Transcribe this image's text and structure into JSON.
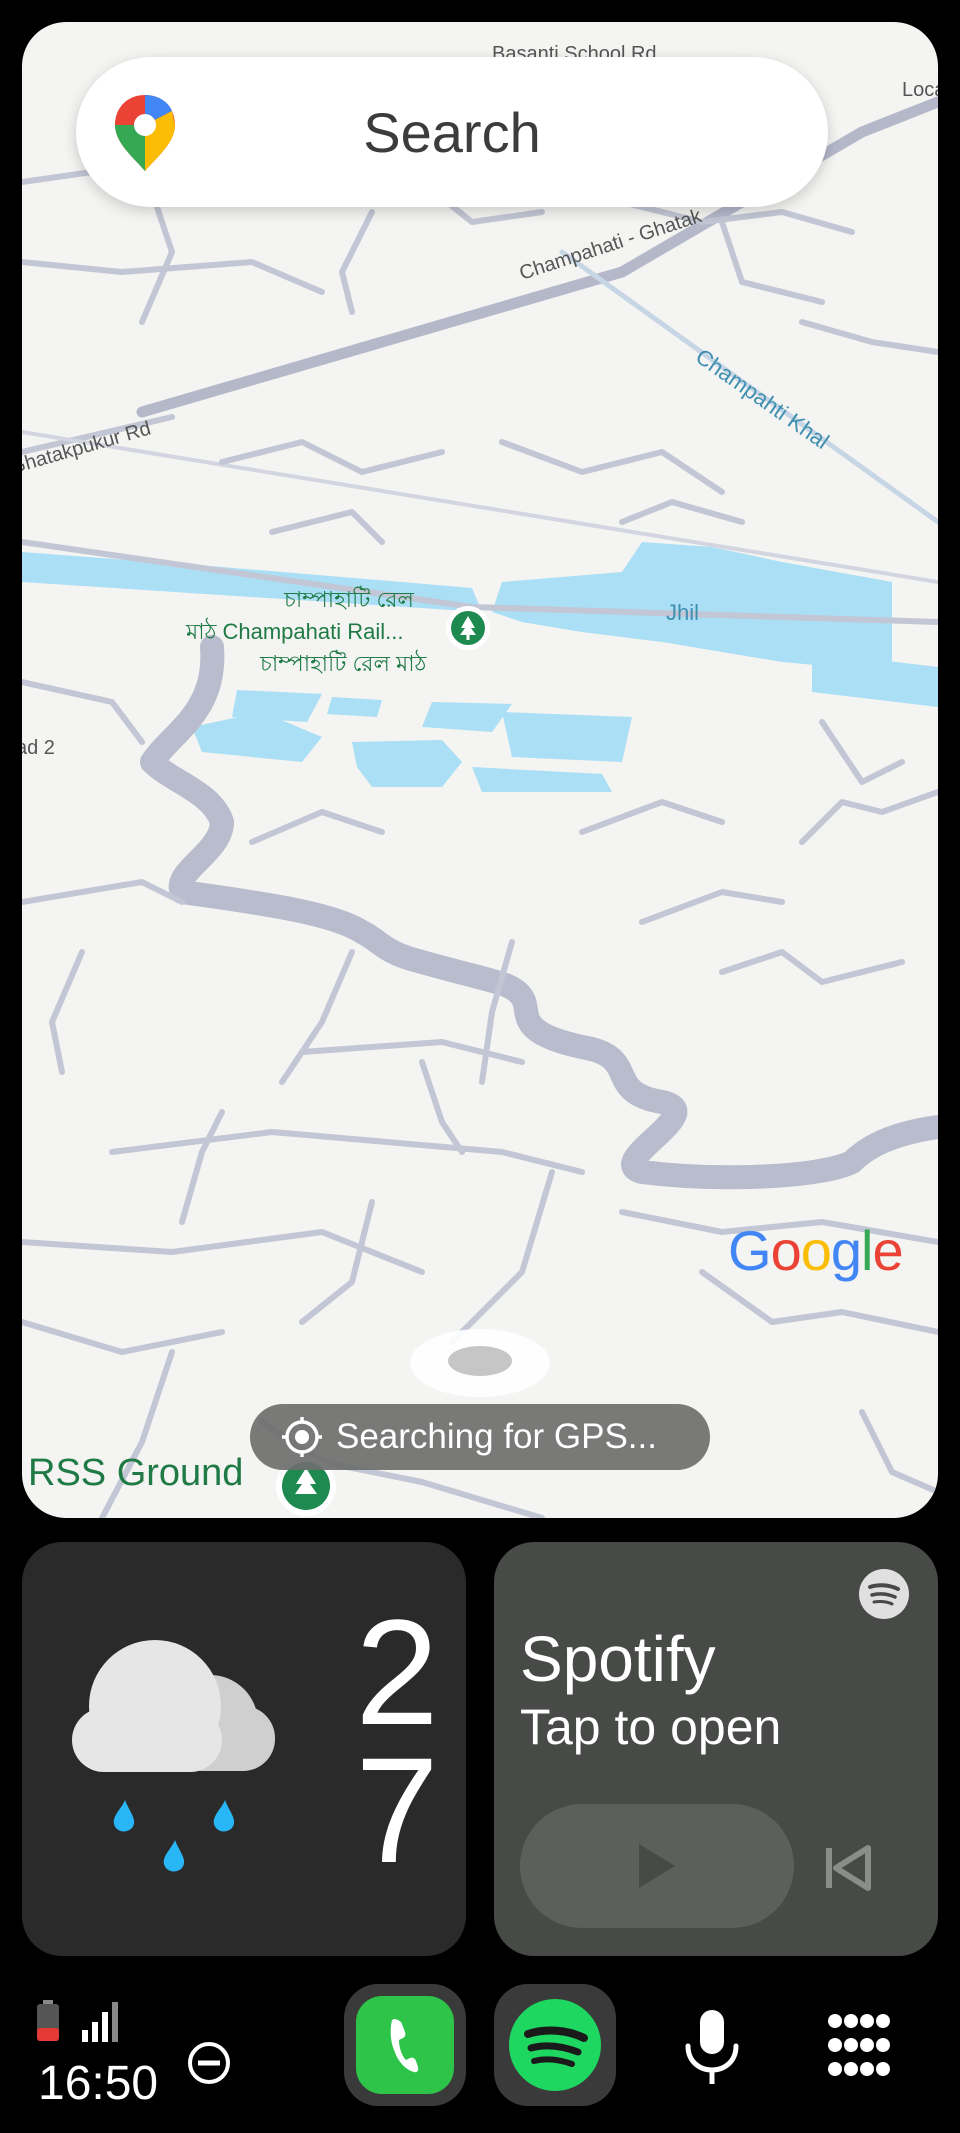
{
  "map": {
    "search_placeholder": "Search",
    "road_labels": {
      "basanti": "Basanti School Rd",
      "local": "Local",
      "champahati_ghatak": "Champahati - Ghatak",
      "champahati_khal": "Champahti Khal",
      "ghatakpukur": "Ghatakpukur Rd",
      "road2": "ad 2"
    },
    "water_label": "Jhil",
    "poi_rail": {
      "line1": "চাম্পাহাটি রেল",
      "line2": "মাঠ Champahati Rail...",
      "line3": "চাম্পাহাটি রেল মাঠ"
    },
    "poi_rss": "RSS Ground",
    "google_letters": [
      "G",
      "o",
      "o",
      "g",
      "l",
      "e"
    ],
    "gps_status": "Searching for GPS..."
  },
  "weather": {
    "temperature": "27",
    "icon": "rain-cloud-icon"
  },
  "spotify": {
    "title": "Spotify",
    "subtitle": "Tap to open"
  },
  "status": {
    "time": "16:50"
  },
  "colors": {
    "map_bg": "#f4f4f2",
    "water": "#aadff5",
    "poi_green": "#1f7a45",
    "spotify_green": "#1ed760",
    "phone_green": "#2ec44a",
    "battery_red": "#e53935"
  }
}
